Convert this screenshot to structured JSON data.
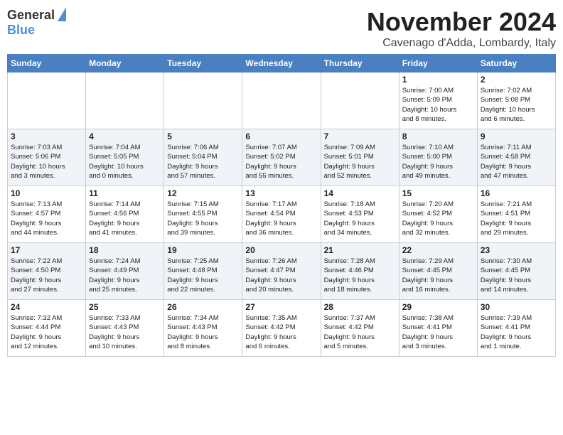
{
  "header": {
    "logo_general": "General",
    "logo_blue": "Blue",
    "month_title": "November 2024",
    "location": "Cavenago d'Adda, Lombardy, Italy"
  },
  "days_of_week": [
    "Sunday",
    "Monday",
    "Tuesday",
    "Wednesday",
    "Thursday",
    "Friday",
    "Saturday"
  ],
  "weeks": [
    [
      {
        "day": "",
        "info": ""
      },
      {
        "day": "",
        "info": ""
      },
      {
        "day": "",
        "info": ""
      },
      {
        "day": "",
        "info": ""
      },
      {
        "day": "",
        "info": ""
      },
      {
        "day": "1",
        "info": "Sunrise: 7:00 AM\nSunset: 5:09 PM\nDaylight: 10 hours\nand 8 minutes."
      },
      {
        "day": "2",
        "info": "Sunrise: 7:02 AM\nSunset: 5:08 PM\nDaylight: 10 hours\nand 6 minutes."
      }
    ],
    [
      {
        "day": "3",
        "info": "Sunrise: 7:03 AM\nSunset: 5:06 PM\nDaylight: 10 hours\nand 3 minutes."
      },
      {
        "day": "4",
        "info": "Sunrise: 7:04 AM\nSunset: 5:05 PM\nDaylight: 10 hours\nand 0 minutes."
      },
      {
        "day": "5",
        "info": "Sunrise: 7:06 AM\nSunset: 5:04 PM\nDaylight: 9 hours\nand 57 minutes."
      },
      {
        "day": "6",
        "info": "Sunrise: 7:07 AM\nSunset: 5:02 PM\nDaylight: 9 hours\nand 55 minutes."
      },
      {
        "day": "7",
        "info": "Sunrise: 7:09 AM\nSunset: 5:01 PM\nDaylight: 9 hours\nand 52 minutes."
      },
      {
        "day": "8",
        "info": "Sunrise: 7:10 AM\nSunset: 5:00 PM\nDaylight: 9 hours\nand 49 minutes."
      },
      {
        "day": "9",
        "info": "Sunrise: 7:11 AM\nSunset: 4:58 PM\nDaylight: 9 hours\nand 47 minutes."
      }
    ],
    [
      {
        "day": "10",
        "info": "Sunrise: 7:13 AM\nSunset: 4:57 PM\nDaylight: 9 hours\nand 44 minutes."
      },
      {
        "day": "11",
        "info": "Sunrise: 7:14 AM\nSunset: 4:56 PM\nDaylight: 9 hours\nand 41 minutes."
      },
      {
        "day": "12",
        "info": "Sunrise: 7:15 AM\nSunset: 4:55 PM\nDaylight: 9 hours\nand 39 minutes."
      },
      {
        "day": "13",
        "info": "Sunrise: 7:17 AM\nSunset: 4:54 PM\nDaylight: 9 hours\nand 36 minutes."
      },
      {
        "day": "14",
        "info": "Sunrise: 7:18 AM\nSunset: 4:53 PM\nDaylight: 9 hours\nand 34 minutes."
      },
      {
        "day": "15",
        "info": "Sunrise: 7:20 AM\nSunset: 4:52 PM\nDaylight: 9 hours\nand 32 minutes."
      },
      {
        "day": "16",
        "info": "Sunrise: 7:21 AM\nSunset: 4:51 PM\nDaylight: 9 hours\nand 29 minutes."
      }
    ],
    [
      {
        "day": "17",
        "info": "Sunrise: 7:22 AM\nSunset: 4:50 PM\nDaylight: 9 hours\nand 27 minutes."
      },
      {
        "day": "18",
        "info": "Sunrise: 7:24 AM\nSunset: 4:49 PM\nDaylight: 9 hours\nand 25 minutes."
      },
      {
        "day": "19",
        "info": "Sunrise: 7:25 AM\nSunset: 4:48 PM\nDaylight: 9 hours\nand 22 minutes."
      },
      {
        "day": "20",
        "info": "Sunrise: 7:26 AM\nSunset: 4:47 PM\nDaylight: 9 hours\nand 20 minutes."
      },
      {
        "day": "21",
        "info": "Sunrise: 7:28 AM\nSunset: 4:46 PM\nDaylight: 9 hours\nand 18 minutes."
      },
      {
        "day": "22",
        "info": "Sunrise: 7:29 AM\nSunset: 4:45 PM\nDaylight: 9 hours\nand 16 minutes."
      },
      {
        "day": "23",
        "info": "Sunrise: 7:30 AM\nSunset: 4:45 PM\nDaylight: 9 hours\nand 14 minutes."
      }
    ],
    [
      {
        "day": "24",
        "info": "Sunrise: 7:32 AM\nSunset: 4:44 PM\nDaylight: 9 hours\nand 12 minutes."
      },
      {
        "day": "25",
        "info": "Sunrise: 7:33 AM\nSunset: 4:43 PM\nDaylight: 9 hours\nand 10 minutes."
      },
      {
        "day": "26",
        "info": "Sunrise: 7:34 AM\nSunset: 4:43 PM\nDaylight: 9 hours\nand 8 minutes."
      },
      {
        "day": "27",
        "info": "Sunrise: 7:35 AM\nSunset: 4:42 PM\nDaylight: 9 hours\nand 6 minutes."
      },
      {
        "day": "28",
        "info": "Sunrise: 7:37 AM\nSunset: 4:42 PM\nDaylight: 9 hours\nand 5 minutes."
      },
      {
        "day": "29",
        "info": "Sunrise: 7:38 AM\nSunset: 4:41 PM\nDaylight: 9 hours\nand 3 minutes."
      },
      {
        "day": "30",
        "info": "Sunrise: 7:39 AM\nSunset: 4:41 PM\nDaylight: 9 hours\nand 1 minute."
      }
    ]
  ]
}
